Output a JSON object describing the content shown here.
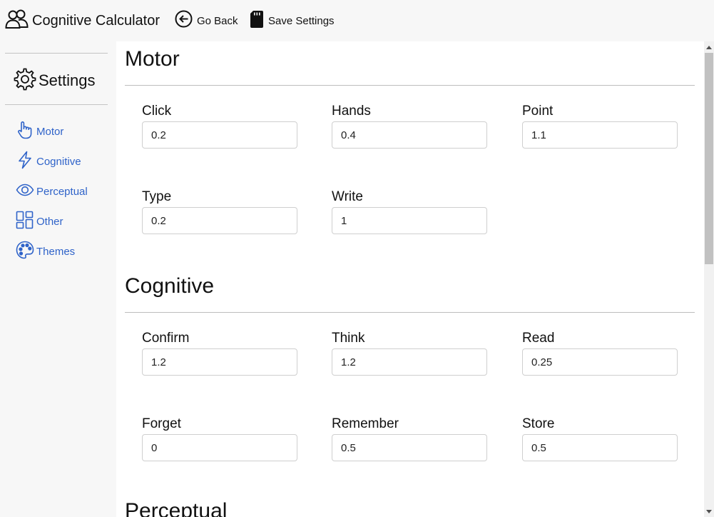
{
  "header": {
    "app_title": "Cognitive Calculator",
    "go_back_label": "Go Back",
    "save_label": "Save Settings"
  },
  "sidebar": {
    "heading": "Settings",
    "items": [
      {
        "label": "Motor",
        "icon": "hand-pointer-icon"
      },
      {
        "label": "Cognitive",
        "icon": "lightning-icon"
      },
      {
        "label": "Perceptual",
        "icon": "eye-icon"
      },
      {
        "label": "Other",
        "icon": "grid-icon"
      },
      {
        "label": "Themes",
        "icon": "palette-icon"
      }
    ]
  },
  "colors": {
    "accent": "#2f63c9",
    "panel": "#ffffff",
    "background": "#f7f7f7"
  },
  "sections": {
    "motor": {
      "title": "Motor",
      "fields": [
        {
          "label": "Click",
          "value": "0.2"
        },
        {
          "label": "Hands",
          "value": "0.4"
        },
        {
          "label": "Point",
          "value": "1.1"
        },
        {
          "label": "Type",
          "value": "0.2"
        },
        {
          "label": "Write",
          "value": "1"
        }
      ]
    },
    "cognitive": {
      "title": "Cognitive",
      "fields": [
        {
          "label": "Confirm",
          "value": "1.2"
        },
        {
          "label": "Think",
          "value": "1.2"
        },
        {
          "label": "Read",
          "value": "0.25"
        },
        {
          "label": "Forget",
          "value": "0"
        },
        {
          "label": "Remember",
          "value": "0.5"
        },
        {
          "label": "Store",
          "value": "0.5"
        }
      ]
    },
    "perceptual": {
      "title": "Perceptual"
    }
  }
}
